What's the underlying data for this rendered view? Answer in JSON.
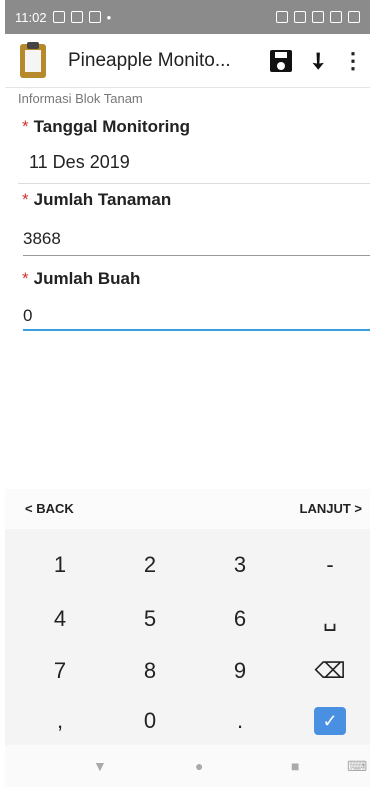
{
  "status": {
    "time": "11:02",
    "dot": "•"
  },
  "app": {
    "title": "Pineapple Monito..."
  },
  "form": {
    "section": "Informasi Blok Tanam",
    "required_mark": "*",
    "tanggal_label": "Tanggal Monitoring",
    "tanggal_value": "11 Des 2019",
    "tanaman_label": "Jumlah Tanaman",
    "tanaman_value": "3868",
    "buah_label": "Jumlah Buah",
    "buah_value": "0"
  },
  "keyboard": {
    "back": "< BACK",
    "next": "LANJUT >",
    "keys": [
      "1",
      "2",
      "3",
      "-",
      "4",
      "5",
      "6",
      "␣",
      "7",
      "8",
      "9",
      "⌫",
      ",",
      "0",
      "."
    ],
    "enter": "✓"
  },
  "icons": {
    "down": "▼",
    "home": "●",
    "recent": "■",
    "kbd": "⌨"
  }
}
